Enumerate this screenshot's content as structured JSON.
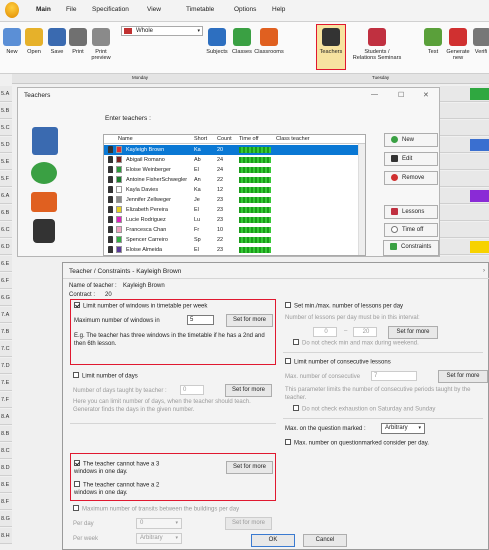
{
  "menubar": {
    "items": [
      "Main",
      "File",
      "Specification",
      "View",
      "Timetable",
      "Options",
      "Help"
    ],
    "active": "Main"
  },
  "ribbon": {
    "buttons": [
      {
        "label": "New",
        "icon": "new-document-icon",
        "color": "#5b8fd6"
      },
      {
        "label": "Open",
        "icon": "open-folder-icon",
        "color": "#e6b12a"
      },
      {
        "label": "Save",
        "icon": "save-disk-icon",
        "color": "#3a6ab0"
      },
      {
        "label": "Print",
        "icon": "printer-icon",
        "color": "#707070"
      },
      {
        "label": "Print preview",
        "icon": "print-preview-icon",
        "color": "#8a8a8a"
      },
      {
        "label": "Subjects",
        "icon": "subjects-icon",
        "color": "#2d6fc0"
      },
      {
        "label": "Classes",
        "icon": "classes-icon",
        "color": "#3aa043"
      },
      {
        "label": "Classrooms",
        "icon": "classrooms-icon",
        "color": "#e06020"
      },
      {
        "label": "Teachers",
        "icon": "teacher-icon",
        "color": "#e0a020"
      },
      {
        "label": "Students / Relations Seminars",
        "icon": "students-icon",
        "color": "#c03040"
      },
      {
        "label": "Test",
        "icon": "test-icon",
        "color": "#5aa03a"
      },
      {
        "label": "Generate new",
        "icon": "generate-icon",
        "color": "#d03030"
      },
      {
        "label": "Verifi",
        "icon": "verify-icon",
        "color": "#777777"
      }
    ],
    "view_select": "Whole",
    "sub_left": "Monday",
    "sub_right": "Tuesday"
  },
  "grid": {
    "rows": [
      "5.A",
      "5.B",
      "5.C",
      "5.D",
      "5.E",
      "5.F",
      "6.A",
      "6.B",
      "6.C",
      "6.D",
      "6.E",
      "6.F",
      "6.G",
      "7.A",
      "7.B",
      "7.C",
      "7.D",
      "7.E",
      "7.F",
      "8.A",
      "8.B",
      "8.C",
      "8.D",
      "8.E",
      "8.F",
      "8.G",
      "8.H"
    ]
  },
  "teachers": {
    "title": "Teachers",
    "controls": {
      "minimize": "—",
      "maximize": "☐",
      "close": "✕"
    },
    "enter_label": "Enter teachers :",
    "columns": [
      "Name",
      "Short",
      "Count",
      "Time off",
      "Class teacher"
    ],
    "rows": [
      {
        "name": "Kayleigh Brown",
        "short": "Ka",
        "count": "20",
        "color": "#e03030",
        "selected": true
      },
      {
        "name": "Abigail Romano",
        "short": "Ab",
        "count": "24",
        "color": "#7a2020"
      },
      {
        "name": "Eloise Weinberger",
        "short": "El",
        "count": "24",
        "color": "#2a9a3a"
      },
      {
        "name": "Antoine FisherSchwegler",
        "short": "An",
        "count": "22",
        "color": "#1a7a2a"
      },
      {
        "name": "Kayla Davies",
        "short": "Ka",
        "count": "12",
        "color": "#ffffff"
      },
      {
        "name": "Jennifer Zellweger",
        "short": "Je",
        "count": "23",
        "color": "#8a8a8a"
      },
      {
        "name": "Elizabeth Pereira",
        "short": "El",
        "count": "23",
        "color": "#e6d020"
      },
      {
        "name": "Lucie Rodriguez",
        "short": "Lu",
        "count": "23",
        "color": "#e020c0"
      },
      {
        "name": "Francesca Chan",
        "short": "Fr",
        "count": "10",
        "color": "#f0a0c0"
      },
      {
        "name": "Spencer Carreiro",
        "short": "Sp",
        "count": "22",
        "color": "#30b040"
      },
      {
        "name": "Eloise Almeida",
        "short": "El",
        "count": "23",
        "color": "#5a3a9a"
      }
    ],
    "buttons": {
      "new": "New",
      "edit": "Edit",
      "remove": "Remove",
      "lessons": "Lessons",
      "timeoff": "Time off",
      "constraints": "Constraints"
    }
  },
  "constraints": {
    "title": "Teacher / Constraints - Kayleigh Brown",
    "name_label": "Name of teacher :",
    "name_value": "Kayleigh Brown",
    "contract_label": "Contract :",
    "contract_value": "20",
    "limit_windows_label": "Limit number of windows in timetable per week",
    "max_windows_label": "Maximum number of windows in",
    "max_windows_value": "5",
    "set_for_more": "Set for more",
    "windows_hint": "E.g. The teacher has three windows in the timetable if he has a 2nd and then 6th lesson.",
    "limit_days_label": "Limit number of days",
    "days_taught_label": "Number of days taught by teacher :",
    "days_taught_value": "0",
    "days_hint": "Here you can limit number of days, when the teacher should teach. Generator finds the days in the given number.",
    "three_windows_label": "The teacher cannot have a 3 windows in one day.",
    "two_windows_label": "The teacher cannot have a 2 windows in one day.",
    "transits_label": "Maximum number of transits between the buildings per day",
    "per_day_label": "Per day",
    "per_day_value": "0",
    "per_week_label": "Per week",
    "per_week_value": "Arbitrary",
    "minmax_label": "Set min./max. number of lessons per day",
    "minmax_hint": "Number of lessons per day must be in this interval:",
    "min_value": "0",
    "max_value": "20",
    "weekend_label": "Do not check min and max during weekend.",
    "consecutive_label": "Limit number of consecutive lessons",
    "max_consecutive_label": "Max. number of consecutive",
    "max_consecutive_value": "7",
    "consecutive_hint": "This parameter limits the number of consecutive periods taught by the teacher.",
    "sat_sun_label": "Do not check exhaustion on Saturday and Sunday",
    "question_label": "Max. on the question marked :",
    "question_value": "Arbitrary",
    "questionmarked_label": "Max. number on questionmarked consider per day.",
    "ok": "OK",
    "cancel": "Cancel"
  }
}
